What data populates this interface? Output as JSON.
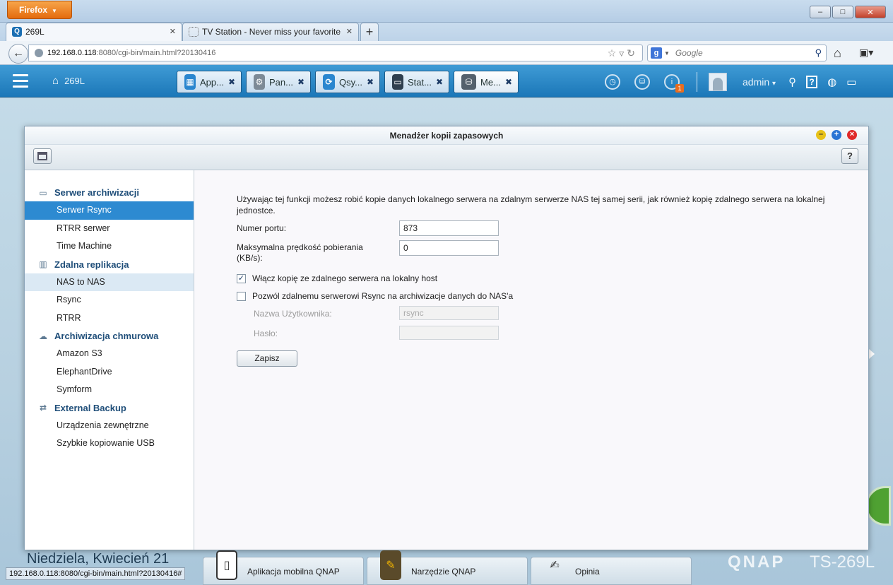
{
  "browser": {
    "menu_label": "Firefox",
    "window_buttons": [
      "–",
      "□",
      "✕"
    ],
    "tabs": [
      {
        "label": "269L",
        "close": "✕"
      },
      {
        "label": "TV Station - Never miss your favorite ...",
        "close": "✕"
      }
    ],
    "new_tab": "+",
    "url_host": "192.168.0.118",
    "url_rest": ":8080/cgi-bin/main.html?20130416",
    "search_placeholder": "Google",
    "status_url": "192.168.0.118:8080/cgi-bin/main.html?20130416#"
  },
  "qnap": {
    "home_label": "269L",
    "app_tabs": [
      {
        "label": "App...",
        "icon": "apps-grid-icon",
        "color": "#2a86cf",
        "glyph": "▦"
      },
      {
        "label": "Pan...",
        "icon": "control-panel-gear-icon",
        "color": "#7d8a96",
        "glyph": "⚙"
      },
      {
        "label": "Qsy...",
        "icon": "qsync-icon",
        "color": "#2a86cf",
        "glyph": "⟳"
      },
      {
        "label": "Stat...",
        "icon": "station-monitor-icon",
        "color": "#2f3f4f",
        "glyph": "▭"
      },
      {
        "label": "Me...",
        "icon": "backup-manager-icon",
        "color": "#54606c",
        "glyph": "⛁"
      }
    ],
    "notification_badge": "1",
    "user": "admin"
  },
  "window": {
    "title": "Menadżer kopii zapasowych",
    "help": "?"
  },
  "sidebar": {
    "sections": [
      {
        "label": "Serwer archiwizacji",
        "icon": "server-icon",
        "items": [
          {
            "label": "Serwer Rsync",
            "state": "selected"
          },
          {
            "label": "RTRR serwer",
            "state": ""
          },
          {
            "label": "Time Machine",
            "state": ""
          }
        ]
      },
      {
        "label": "Zdalna replikacja",
        "icon": "replication-icon",
        "items": [
          {
            "label": "NAS to NAS",
            "state": "hover"
          },
          {
            "label": "Rsync",
            "state": ""
          },
          {
            "label": "RTRR",
            "state": ""
          }
        ]
      },
      {
        "label": "Archiwizacja chmurowa",
        "icon": "cloud-icon",
        "items": [
          {
            "label": "Amazon S3",
            "state": ""
          },
          {
            "label": "ElephantDrive",
            "state": ""
          },
          {
            "label": "Symform",
            "state": ""
          }
        ]
      },
      {
        "label": "External Backup",
        "icon": "sync-arrows-icon",
        "items": [
          {
            "label": "Urządzenia zewnętrzne",
            "state": ""
          },
          {
            "label": "Szybkie kopiowanie USB",
            "state": ""
          }
        ]
      }
    ]
  },
  "content": {
    "intro": "Używając tej funkcji możesz robić kopie danych lokalnego serwera na zdalnym serwerze NAS tej samej serii, jak również kopię zdalnego serwera na lokalnej jednostce.",
    "port_label": "Numer portu:",
    "port_value": "873",
    "speed_label": "Maksymalna prędkość pobierania (KB/s):",
    "speed_value": "0",
    "checkbox1_label": "Włącz kopię ze zdalnego serwera na lokalny host",
    "checkbox1_checked": true,
    "checkbox2_label": "Pozwól zdalnemu serwerowi Rsync na archiwizacje danych do NAS'a",
    "checkbox2_checked": false,
    "username_label": "Nazwa Użytkownika:",
    "username_value": "rsync",
    "password_label": "Hasło:",
    "password_value": "",
    "save_label": "Zapisz"
  },
  "desktop": {
    "date": "Niedziela, Kwiecień 21",
    "dock": [
      {
        "label": "Aplikacja mobilna QNAP",
        "icon": "mobile-app-icon"
      },
      {
        "label": "Narzędzie QNAP",
        "icon": "qnap-utility-icon"
      },
      {
        "label": "Opinia",
        "icon": "feedback-pen-icon"
      }
    ],
    "brand": "QNAP",
    "model": "TS-269L"
  }
}
